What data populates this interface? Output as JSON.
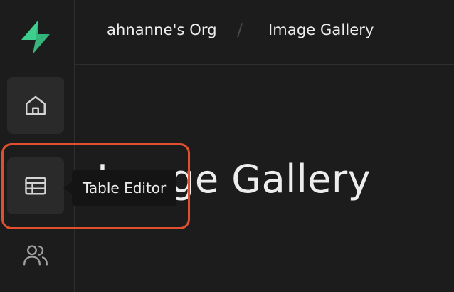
{
  "breadcrumb": {
    "org": "ahnanne's Org",
    "separator": "/",
    "page": "Image Gallery"
  },
  "page": {
    "title": "Image Gallery"
  },
  "sidebar": {
    "items": [
      {
        "name": "home",
        "icon": "home-icon"
      },
      {
        "name": "table-editor",
        "icon": "table-icon",
        "tooltip": "Table Editor"
      },
      {
        "name": "users",
        "icon": "users-icon"
      }
    ]
  },
  "tooltip": {
    "label": "Table Editor"
  },
  "colors": {
    "background": "#1c1c1c",
    "brand_green": "#3ecf8e",
    "highlight": "#e0502f",
    "tooltip_bg": "#141414",
    "nav_active_bg": "#2a2a2a"
  }
}
